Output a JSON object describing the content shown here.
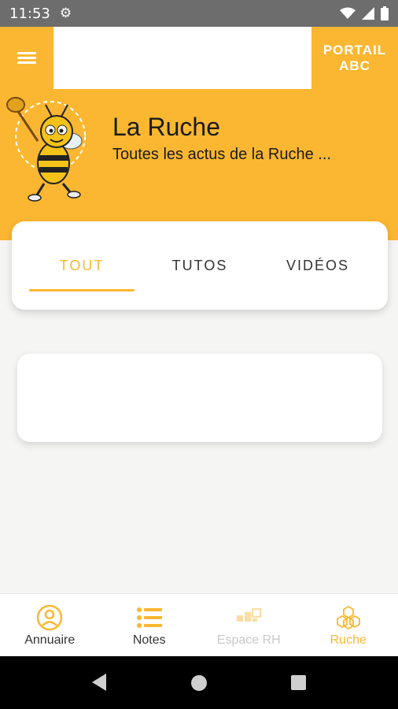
{
  "status_bar": {
    "time": "11:53"
  },
  "app_bar": {
    "portail_line1": "PORTAIL",
    "portail_line2": "ABC"
  },
  "header": {
    "title": "La Ruche",
    "subtitle": "Toutes les actus de la Ruche ..."
  },
  "tabs": [
    {
      "label": "TOUT",
      "active": true
    },
    {
      "label": "TUTOS",
      "active": false
    },
    {
      "label": "VIDÉOS",
      "active": false
    }
  ],
  "bottom_nav": [
    {
      "label": "Annuaire",
      "icon": "person-circle-icon",
      "state": "normal"
    },
    {
      "label": "Notes",
      "icon": "list-icon",
      "state": "normal"
    },
    {
      "label": "Espace RH",
      "icon": "puzzle-icon",
      "state": "disabled"
    },
    {
      "label": "Ruche",
      "icon": "honeycomb-icon",
      "state": "active"
    }
  ],
  "colors": {
    "accent": "#fbb731",
    "status_bar": "#6d6d6d"
  }
}
